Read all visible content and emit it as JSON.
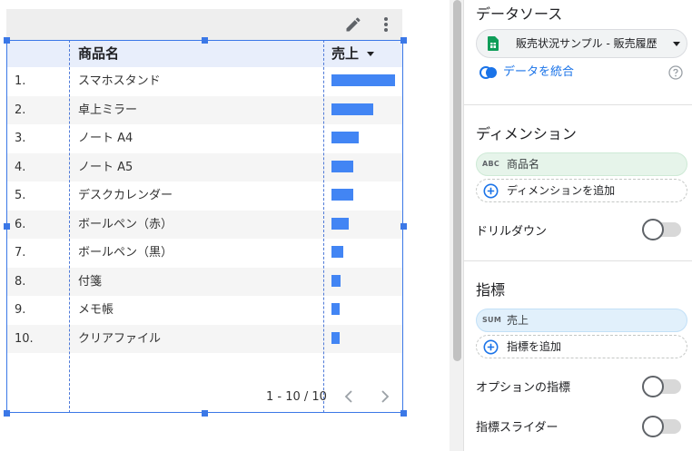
{
  "table": {
    "headers": {
      "name": "商品名",
      "sales": "売上"
    },
    "rows": [
      {
        "num": "1.",
        "name": "スマホスタンド",
        "sales_fraction": 1.0
      },
      {
        "num": "2.",
        "name": "卓上ミラー",
        "sales_fraction": 0.66
      },
      {
        "num": "3.",
        "name": "ノート A4",
        "sales_fraction": 0.43
      },
      {
        "num": "4.",
        "name": "ノート A5",
        "sales_fraction": 0.34
      },
      {
        "num": "5.",
        "name": "デスクカレンダー",
        "sales_fraction": 0.34
      },
      {
        "num": "6.",
        "name": "ボールペン（赤）",
        "sales_fraction": 0.27
      },
      {
        "num": "7.",
        "name": "ボールペン（黒）",
        "sales_fraction": 0.18
      },
      {
        "num": "8.",
        "name": "付箋",
        "sales_fraction": 0.14
      },
      {
        "num": "9.",
        "name": "メモ帳",
        "sales_fraction": 0.13
      },
      {
        "num": "10.",
        "name": "クリアファイル",
        "sales_fraction": 0.13
      }
    ],
    "pagination": "1 - 10 / 10",
    "bar_color": "#4285f4"
  },
  "panel": {
    "data_source": {
      "title": "データソース",
      "selected": "販売状況サンプル - 販売履歴",
      "blend_label": "データを統合"
    },
    "dimension": {
      "title": "ディメンション",
      "chip_type": "ABC",
      "chip_label": "商品名",
      "add_label": "ディメンションを追加",
      "drilldown_label": "ドリルダウン"
    },
    "metric": {
      "title": "指標",
      "chip_type": "SUM",
      "chip_label": "売上",
      "add_label": "指標を追加",
      "optional_label": "オプションの指標",
      "slider_label": "指標スライダー"
    }
  },
  "icons": {
    "edit": "pencil-icon",
    "more": "more-vert-icon",
    "sort": "sort-desc-icon",
    "prev": "chevron-left-icon",
    "next": "chevron-right-icon",
    "sheets": "google-sheets-icon",
    "blend": "blend-icon",
    "help": "help-icon",
    "add": "add-circle-icon"
  },
  "colors": {
    "selection": "#3b78e7",
    "link": "#1a73e8",
    "dimension_chip": "#e6f4ea",
    "metric_chip": "#e1f0fb"
  }
}
